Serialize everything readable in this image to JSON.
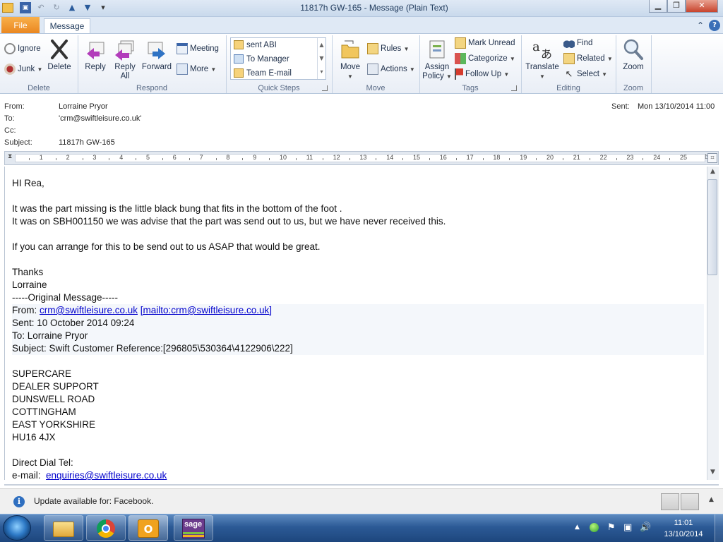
{
  "window": {
    "title": "11817h  GW-165  -  Message (Plain Text)"
  },
  "tabs": {
    "file": "File",
    "message": "Message"
  },
  "ribbon": {
    "delete_group": {
      "label": "Delete",
      "ignore": "Ignore",
      "junk": "Junk",
      "delete": "Delete"
    },
    "respond_group": {
      "label": "Respond",
      "reply": "Reply",
      "reply_all": "Reply\nAll",
      "forward": "Forward",
      "meeting": "Meeting",
      "more": "More"
    },
    "quick_steps": {
      "label": "Quick Steps",
      "items": [
        "sent ABI",
        "To Manager",
        "Team E-mail"
      ]
    },
    "move_group": {
      "label": "Move",
      "move": "Move",
      "rules": "Rules",
      "actions": "Actions"
    },
    "tags_group": {
      "label": "Tags",
      "assign_policy": "Assign\nPolicy",
      "mark_unread": "Mark Unread",
      "categorize": "Categorize",
      "follow_up": "Follow Up"
    },
    "editing_group": {
      "label": "Editing",
      "translate": "Translate",
      "find": "Find",
      "related": "Related",
      "select": "Select"
    },
    "zoom_group": {
      "label": "Zoom",
      "zoom": "Zoom"
    }
  },
  "header": {
    "from_label": "From:",
    "from_value": "Lorraine Pryor",
    "to_label": "To:",
    "to_value": "'crm@swiftleisure.co.uk'",
    "cc_label": "Cc:",
    "cc_value": "",
    "subject_label": "Subject:",
    "subject_value": "11817h  GW-165",
    "sent_label": "Sent:",
    "sent_value": "Mon 13/10/2014 11:00"
  },
  "ruler": {
    "ticks": [
      "1",
      "2",
      "3",
      "4",
      "5",
      "6",
      "7",
      "8",
      "9",
      "10",
      "11",
      "12",
      "13",
      "14",
      "15",
      "16",
      "17",
      "18",
      "19",
      "20",
      "21",
      "22",
      "23",
      "24",
      "25"
    ]
  },
  "body": {
    "greeting": "HI Rea,",
    "line1": "It was the part missing is the little black bung that fits in the bottom of the foot .",
    "line2": "It was on SBH001150 we was advise that the part was send out to us, but we have never received this.",
    "line3": "If you can arrange for this to be send out to us ASAP that would be great.",
    "thanks": "Thanks",
    "signoff": "Lorraine",
    "orig_sep": "-----Original Message-----",
    "orig_from_label": "From: ",
    "orig_from_email": "crm@swiftleisure.co.uk",
    "orig_from_mailto": "[mailto:crm@swiftleisure.co.uk]",
    "orig_sent": "Sent: 10 October 2014 09:24",
    "orig_to": "To: Lorraine Pryor",
    "orig_subject": "Subject: Swift Customer Reference:[296805\\530364\\4122906\\222]",
    "addr1": "SUPERCARE",
    "addr2": "DEALER SUPPORT",
    "addr3": "DUNSWELL ROAD",
    "addr4": "COTTINGHAM",
    "addr5": "EAST YORKSHIRE",
    "addr6": "HU16 4JX",
    "direct_dial": "Direct Dial Tel:",
    "email_label": "e-mail:  ",
    "email_value": "enquiries@swiftleisure.co.uk"
  },
  "notification": {
    "text": "Update available for: Facebook."
  },
  "taskbar": {
    "time": "11:01",
    "date": "13/10/2014",
    "sage_label": "sage"
  }
}
